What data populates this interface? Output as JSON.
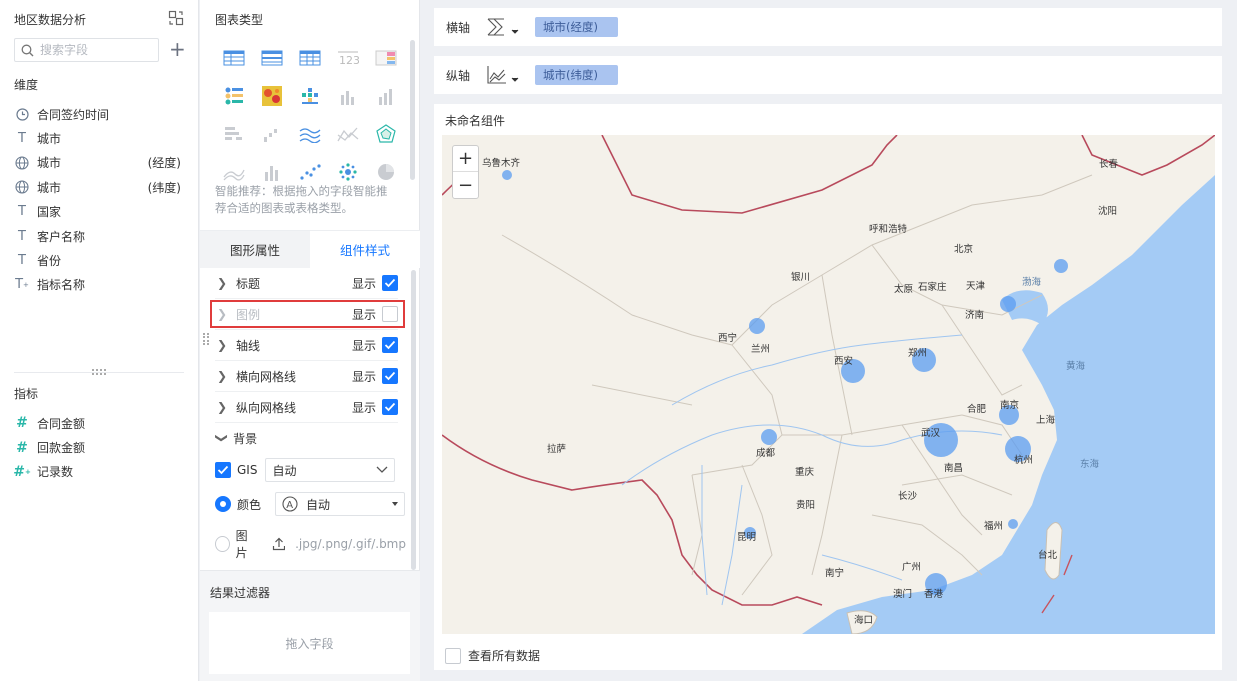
{
  "left": {
    "title": "地区数据分析",
    "search_placeholder": "搜索字段",
    "dimensions_label": "维度",
    "dimensions": [
      {
        "icon": "clock-icon",
        "label": "合同签约时间",
        "suffix": ""
      },
      {
        "icon": "text-icon",
        "label": "城市",
        "suffix": ""
      },
      {
        "icon": "globe-icon",
        "label": "城市",
        "suffix": "(经度)"
      },
      {
        "icon": "globe-icon",
        "label": "城市",
        "suffix": "(纬度)"
      },
      {
        "icon": "text-icon",
        "label": "国家",
        "suffix": ""
      },
      {
        "icon": "text-icon",
        "label": "客户名称",
        "suffix": ""
      },
      {
        "icon": "text-icon",
        "label": "省份",
        "suffix": ""
      },
      {
        "icon": "text-plus-icon",
        "label": "指标名称",
        "suffix": ""
      }
    ],
    "measures_label": "指标",
    "measures": [
      {
        "icon": "hash-icon",
        "label": "合同金额"
      },
      {
        "icon": "hash-icon",
        "label": "回款金额"
      },
      {
        "icon": "hash-plus-icon",
        "label": "记录数"
      }
    ]
  },
  "mid": {
    "chart_type_title": "图表类型",
    "smart_recommendation": "智能推荐：根据拖入的字段智能推荐合适的图表或表格类型。",
    "tabs": [
      "图形属性",
      "组件样式"
    ],
    "active_tab": 1,
    "properties": [
      {
        "label": "标题",
        "show": "显示",
        "checked": true,
        "disabled": false
      },
      {
        "label": "图例",
        "show": "显示",
        "checked": false,
        "disabled": true
      },
      {
        "label": "轴线",
        "show": "显示",
        "checked": true,
        "disabled": false
      },
      {
        "label": "横向网格线",
        "show": "显示",
        "checked": true,
        "disabled": false
      },
      {
        "label": "纵向网格线",
        "show": "显示",
        "checked": true,
        "disabled": false
      }
    ],
    "background": {
      "label": "背景",
      "gis_label": "GIS",
      "gis_value": "自动",
      "color_label": "颜色",
      "color_value": "自动",
      "image_label": "图片",
      "image_hint": ".jpg/.png/.gif/.bmp"
    },
    "result_filter": {
      "title": "结果过滤器",
      "drop_hint": "拖入字段"
    }
  },
  "axes": {
    "x_label": "横轴",
    "x_field": "城市(经度)",
    "y_label": "纵轴",
    "y_field": "城市(纬度)"
  },
  "widget": {
    "title": "未命名组件",
    "view_all": "查看所有数据",
    "zoom_in": "+",
    "zoom_out": "−",
    "map_labels": [
      "乌鲁木齐",
      "长春",
      "沈阳",
      "呼和浩特",
      "北京",
      "银川",
      "太原",
      "石家庄",
      "天津",
      "渤海",
      "济南",
      "西宁",
      "兰州",
      "西安",
      "郑州",
      "黄海",
      "合肥",
      "南京",
      "上海",
      "拉萨",
      "武汉",
      "成都",
      "重庆",
      "杭州",
      "东海",
      "南昌",
      "长沙",
      "贵阳",
      "福州",
      "昆明",
      "台北",
      "南宁",
      "广州",
      "澳门",
      "香港",
      "海口"
    ]
  },
  "colors": {
    "accent": "#1677ff",
    "tag_bg": "#aac4f0",
    "bubble": "#5b9cf0",
    "highlight": "#e03c3c",
    "sea": "#a4cbf5",
    "land": "#f4f1ea"
  }
}
